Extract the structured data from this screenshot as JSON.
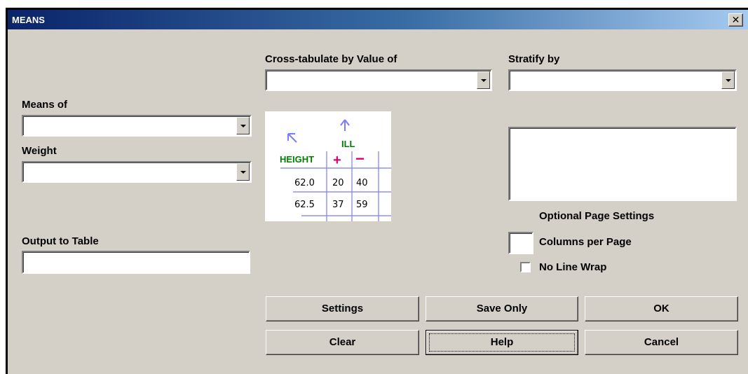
{
  "window": {
    "title": "MEANS",
    "close_glyph": "✕"
  },
  "labels": {
    "cross_tabulate": "Cross-tabulate by Value of",
    "stratify": "Stratify by",
    "means_of": "Means of",
    "weight": "Weight",
    "output_to_table": "Output to Table",
    "optional_page_settings": "Optional Page Settings",
    "columns_per_page": "Columns per Page",
    "no_line_wrap": "No Line Wrap"
  },
  "fields": {
    "cross_tabulate_value": "",
    "stratify_value": "",
    "means_of_value": "",
    "weight_value": "",
    "output_table_value": "",
    "columns_per_page_value": ""
  },
  "checkboxes": {
    "no_line_wrap": false
  },
  "buttons": {
    "settings": "Settings",
    "save_only": "Save Only",
    "ok": "OK",
    "clear": "Clear",
    "help": "Help",
    "cancel": "Cancel"
  },
  "illustration": {
    "row_header": "HEIGHT",
    "col_header": "ILL",
    "plus": "+",
    "minus": "−",
    "rows": [
      {
        "label": "62.0",
        "plus": "20",
        "minus": "40"
      },
      {
        "label": "62.5",
        "plus": "37",
        "minus": "59"
      }
    ]
  },
  "colors": {
    "title_start": "#0a246a",
    "title_end": "#a6caf0",
    "face": "#d4d0c8",
    "illus_green": "#008000",
    "illus_red": "#e0006b",
    "illus_grid": "#7b7bff"
  }
}
